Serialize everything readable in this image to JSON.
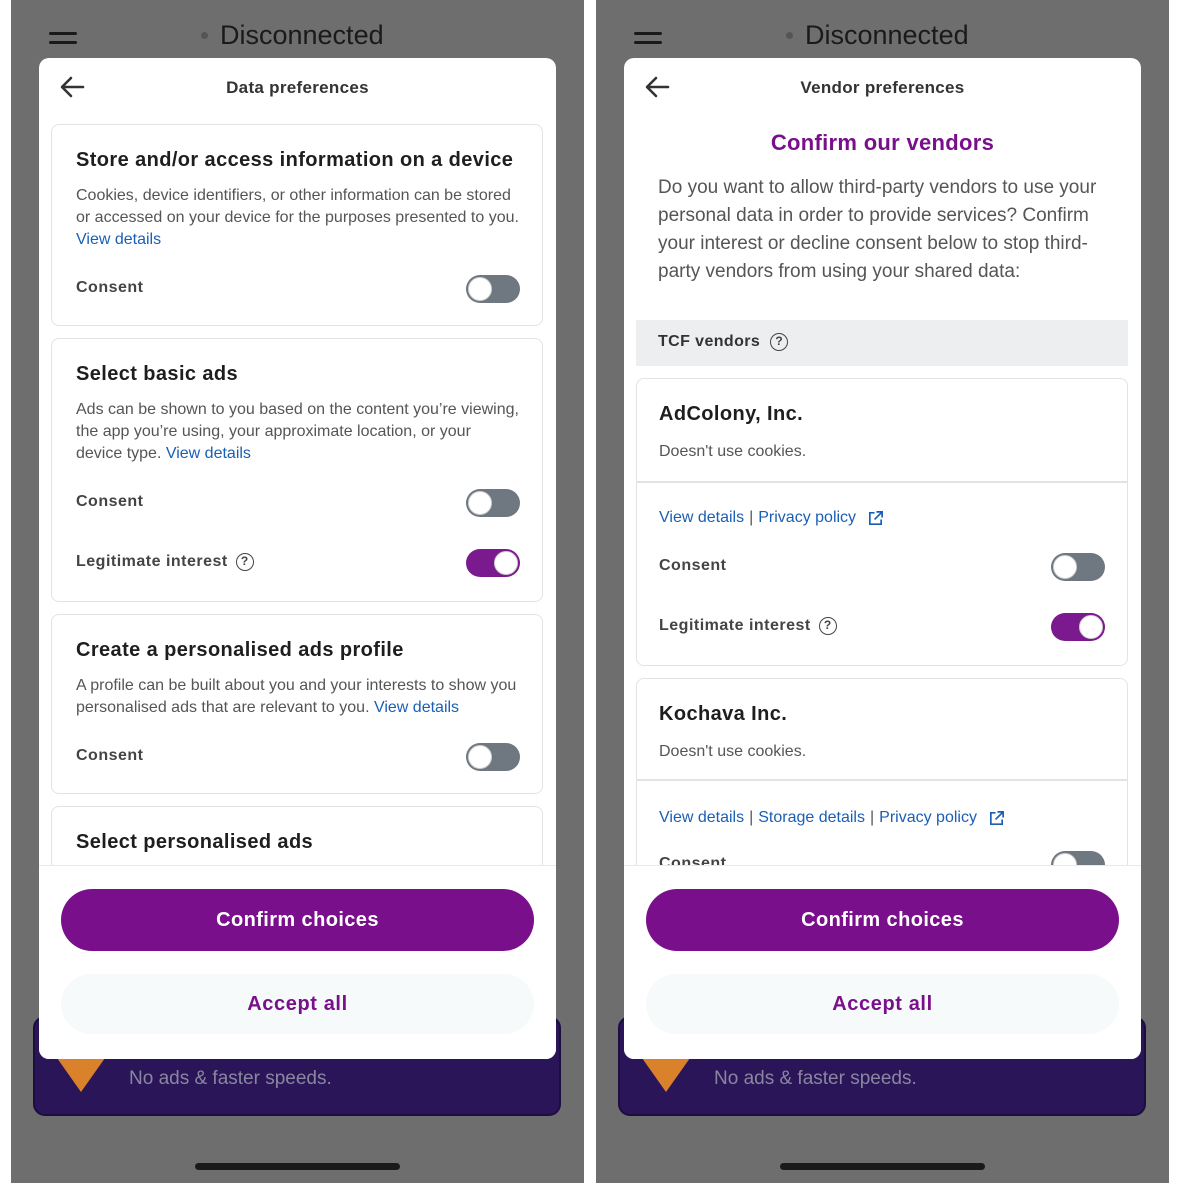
{
  "status": {
    "label": "Disconnected"
  },
  "promo": {
    "text": "No ads & faster speeds."
  },
  "left": {
    "title": "Data preferences",
    "cards": [
      {
        "title": "Store and/or access information on a device",
        "desc": "Cookies, device identifiers, or other information can be stored or accessed on your device for the purposes presented to you.",
        "link": "View details",
        "consent_label": "Consent",
        "consent_on": false
      },
      {
        "title": "Select basic ads",
        "desc": "Ads can be shown to you based on the content you’re viewing, the app you’re using, your approximate location, or your device type.",
        "link": "View details",
        "consent_label": "Consent",
        "consent_on": false,
        "legit_label": "Legitimate interest",
        "legit_on": true
      },
      {
        "title": "Create a personalised ads profile",
        "desc": "A profile can be built about you and your interests to show you personalised ads that are relevant to you.",
        "link": "View details",
        "consent_label": "Consent",
        "consent_on": false
      },
      {
        "title": "Select personalised ads"
      }
    ],
    "confirm": "Confirm choices",
    "accept": "Accept all"
  },
  "right": {
    "title": "Vendor preferences",
    "heading": "Confirm our vendors",
    "intro": "Do you want to allow third-party vendors to use your personal data in order to provide services? Confirm your interest or decline consent below to stop third-party vendors from using your shared data:",
    "section": "TCF vendors",
    "vendors": [
      {
        "name": "AdColony, Inc.",
        "cookies": "Doesn't use cookies.",
        "link_details": "View details",
        "link_privacy": "Privacy policy",
        "consent_label": "Consent",
        "consent_on": false,
        "legit_label": "Legitimate interest",
        "legit_on": true
      },
      {
        "name": "Kochava Inc.",
        "cookies": "Doesn't use cookies.",
        "link_details": "View details",
        "link_storage": "Storage details",
        "link_privacy": "Privacy policy",
        "consent_label": "Consent",
        "consent_on": false
      }
    ],
    "confirm": "Confirm choices",
    "accept": "Accept all"
  },
  "colors": {
    "accent": "#7a0f8c",
    "link": "#1a5fb4",
    "toggle_off": "#6f7780"
  }
}
